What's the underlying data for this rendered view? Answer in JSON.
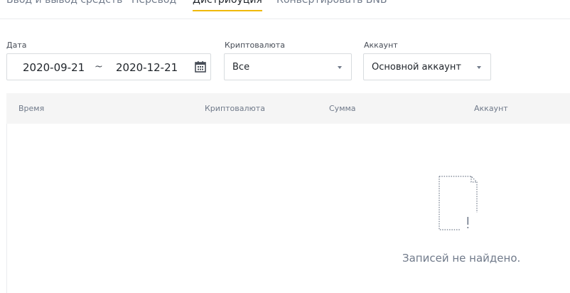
{
  "tabs": [
    {
      "label": "Ввод и вывод средств",
      "active": false
    },
    {
      "label": "Перевод",
      "active": false
    },
    {
      "label": "Дистрибуция",
      "active": true
    },
    {
      "label": "Конвертировать BNB",
      "active": false
    }
  ],
  "filters": {
    "date": {
      "label": "Дата",
      "from": "2020-09-21",
      "separator": "~",
      "to": "2020-12-21"
    },
    "crypto": {
      "label": "Криптовалюта",
      "value": "Все"
    },
    "account": {
      "label": "Аккаунт",
      "value": "Основной аккаунт"
    }
  },
  "table": {
    "columns": [
      "Время",
      "Криптовалюта",
      "Сумма",
      "Аккаунт"
    ],
    "empty_text": "Записей не найдено."
  },
  "colors": {
    "accent": "#f0b90b",
    "header_bg": "#f5f5f5",
    "muted": "#707a8a"
  },
  "icons": {
    "calendar": "calendar-icon",
    "empty": "empty-document-icon"
  }
}
